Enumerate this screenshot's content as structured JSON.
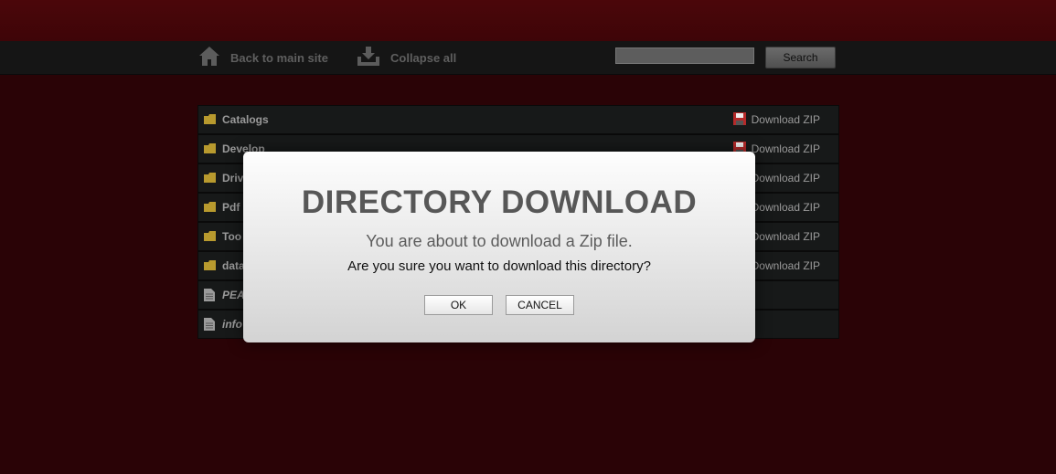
{
  "nav": {
    "back_label": "Back to main site",
    "collapse_label": "Collapse all",
    "search_value": "",
    "search_button": "Search"
  },
  "list": {
    "download_label": "Download ZIP",
    "rows": [
      {
        "name": "Catalogs",
        "type": "folder"
      },
      {
        "name": "Develop",
        "type": "folder"
      },
      {
        "name": "Driv",
        "type": "folder"
      },
      {
        "name": "Pdf",
        "type": "folder"
      },
      {
        "name": "Too",
        "type": "folder"
      },
      {
        "name": "data",
        "type": "folder"
      },
      {
        "name": "PEA",
        "type": "file"
      },
      {
        "name": "info",
        "type": "file"
      }
    ]
  },
  "dialog": {
    "title": "DIRECTORY DOWNLOAD",
    "subtitle": "You are about to download a Zip file.",
    "question": "Are you sure you want to download this directory?",
    "ok_label": "OK",
    "cancel_label": "CANCEL"
  },
  "colors": {
    "background": "#2a0306",
    "navbar": "#151515",
    "row": "#171919",
    "folder_icon": "#b89a2e",
    "zip_icon": "#b52a2a"
  },
  "icons": {
    "home": "home-icon",
    "collapse": "download-tray-icon",
    "folder": "folder-icon",
    "file": "file-icon",
    "zip": "floppy-disk-icon"
  }
}
